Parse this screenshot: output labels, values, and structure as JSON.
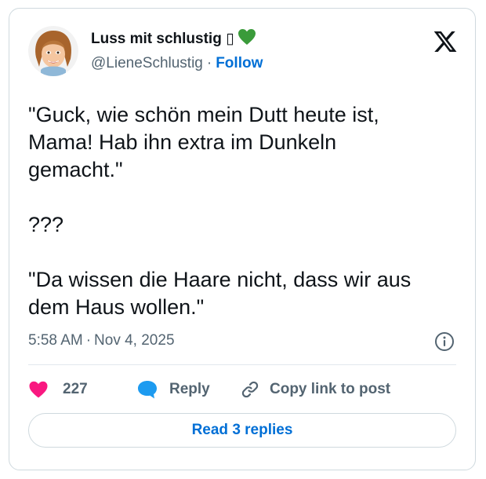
{
  "author": {
    "name": "Luss mit schlustig ▯",
    "name_emoji": "green-heart-emoji",
    "handle": "@LieneSchlustig",
    "separator": "·",
    "follow_label": "Follow",
    "avatar": "avatar-woman-cartoon"
  },
  "tweet": {
    "paragraphs": [
      "\"Guck, wie schön mein Dutt heute ist,\nMama! Hab ihn extra im Dunkeln\ngemacht.\"",
      "???",
      "\"Da wissen die Haare nicht, dass wir aus\ndem Haus wollen.\""
    ],
    "time": "5:58 AM",
    "separator": "·",
    "date": "Nov 4, 2025"
  },
  "actions": {
    "like_count": "227",
    "reply_label": "Reply",
    "copy_link_label": "Copy link to post"
  },
  "read_replies_label": "Read 3 replies",
  "icons": {
    "brand": "x-logo-icon",
    "info": "info-icon",
    "like": "heart-icon",
    "reply": "speech-bubble-icon",
    "copy": "link-icon"
  },
  "colors": {
    "link_blue": "#006fd6",
    "heart_pink": "#f91880",
    "reply_blue": "#1d9bf0",
    "muted_text": "#536471",
    "border": "#cfd9de",
    "emoji_green": "#3a9b3a"
  }
}
